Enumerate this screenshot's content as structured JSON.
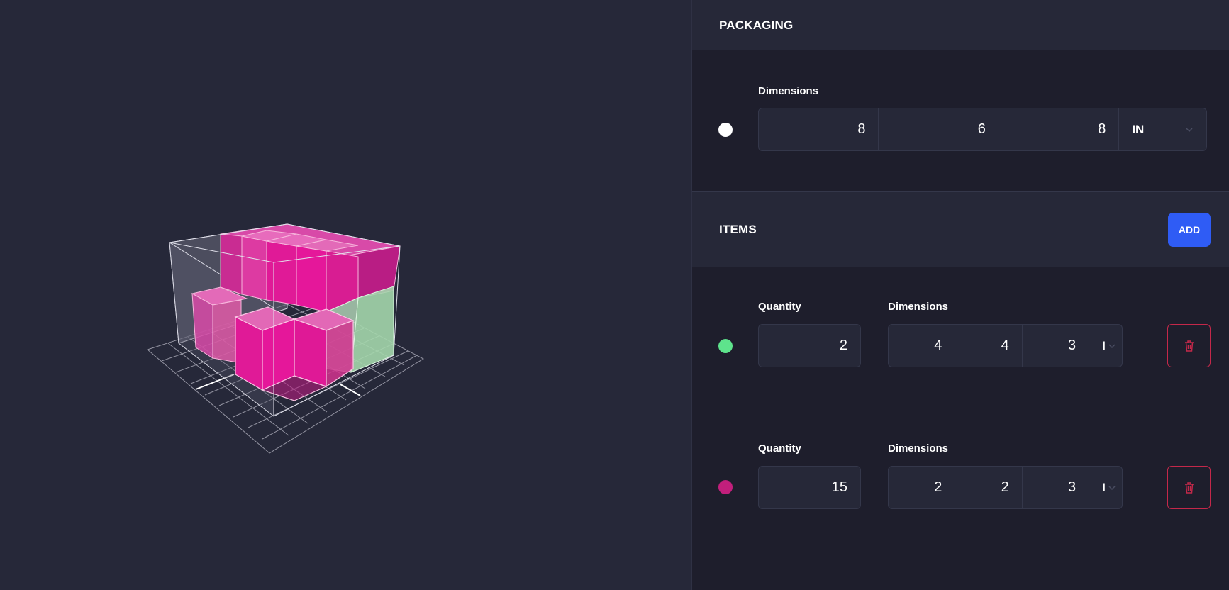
{
  "packaging": {
    "title": "PACKAGING",
    "dimensions_label": "Dimensions",
    "color": "#ffffff",
    "dims": [
      "8",
      "6",
      "8"
    ],
    "unit": "IN"
  },
  "items_section": {
    "title": "ITEMS",
    "add_label": "ADD"
  },
  "items": [
    {
      "quantity_label": "Quantity",
      "quantity": "2",
      "dimensions_label": "Dimensions",
      "dims": [
        "4",
        "4",
        "3"
      ],
      "unit": "I",
      "color": "#5ee38c"
    },
    {
      "quantity_label": "Quantity",
      "quantity": "15",
      "dimensions_label": "Dimensions",
      "dims": [
        "2",
        "2",
        "3"
      ],
      "unit": "I",
      "color": "#c21f7c"
    }
  ],
  "icons": {
    "chevron": "chevron-down-icon",
    "delete": "trash-icon"
  },
  "colors": {
    "accent": "#2f5cf5",
    "danger": "#c4284a",
    "item_magenta": "#e0189a",
    "item_green": "#a8dcb0"
  }
}
